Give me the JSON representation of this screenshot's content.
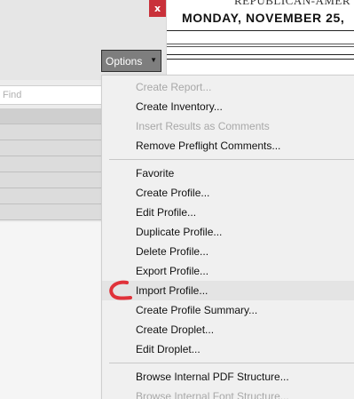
{
  "panel": {
    "close_glyph": "x",
    "options_label": "Options",
    "find_placeholder": "Find"
  },
  "document": {
    "header_text": "REPUBLICAN-AMER",
    "date_text": "MONDAY, NOVEMBER 25,"
  },
  "menu": {
    "items": [
      {
        "label": "Create Report...",
        "enabled": false
      },
      {
        "label": "Create Inventory...",
        "enabled": true
      },
      {
        "label": "Insert Results as Comments",
        "enabled": false
      },
      {
        "label": "Remove Preflight Comments...",
        "enabled": true
      },
      {
        "label": "Favorite",
        "enabled": true
      },
      {
        "label": "Create Profile...",
        "enabled": true
      },
      {
        "label": "Edit Profile...",
        "enabled": true
      },
      {
        "label": "Duplicate Profile...",
        "enabled": true
      },
      {
        "label": "Delete Profile...",
        "enabled": true
      },
      {
        "label": "Export Profile...",
        "enabled": true
      },
      {
        "label": "Import Profile...",
        "enabled": true,
        "highlighted": true
      },
      {
        "label": "Create Profile Summary...",
        "enabled": true
      },
      {
        "label": "Create Droplet...",
        "enabled": true
      },
      {
        "label": "Edit Droplet...",
        "enabled": true
      },
      {
        "label": "Browse Internal PDF Structure...",
        "enabled": true
      },
      {
        "label": "Browse Internal Font Structure...",
        "enabled": false
      }
    ]
  },
  "colors": {
    "close_button": "#c9313a",
    "options_button": "#7e7e7e",
    "menu_background": "#f0f0f0",
    "disabled_text": "#a8a8a8",
    "annotation_mark": "#e0323a"
  }
}
